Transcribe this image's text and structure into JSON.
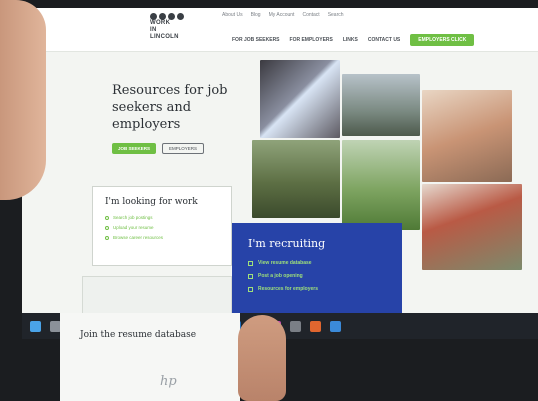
{
  "header": {
    "logo_text": [
      "WORK",
      "IN",
      "LINCOLN"
    ],
    "utility_links": [
      "About Us",
      "Blog",
      "My Account",
      "Contact",
      "Search"
    ],
    "nav_items": [
      "FOR JOB SEEKERS",
      "FOR EMPLOYERS",
      "LINKS",
      "CONTACT US"
    ],
    "cta_label": "EMPLOYERS CLICK"
  },
  "hero": {
    "title": "Resources for job seekers and employers",
    "primary_button": "JOB SEEKERS",
    "secondary_button": "EMPLOYERS"
  },
  "card_work": {
    "title": "I'm looking for work",
    "links": [
      "Search job postings",
      "Upload your resume",
      "Browse career resources"
    ]
  },
  "card_recruit": {
    "title": "I'm recruiting",
    "links": [
      "View resume database",
      "Post a job opening",
      "Resources for employers"
    ]
  },
  "resume_section": {
    "title": "Join the resume database"
  },
  "device": {
    "brand": "hp"
  },
  "colors": {
    "accent_green": "#6fbf44",
    "recruit_blue": "#2743a8",
    "text_dark": "#2b3035"
  },
  "taskbar_icons": [
    "start-icon",
    "search-icon",
    "taskview-icon",
    "edge-icon",
    "explorer-icon",
    "store-icon",
    "mail-icon",
    "chrome-icon",
    "word-icon",
    "excel-icon",
    "outlook-icon",
    "teams-icon",
    "photos-icon",
    "settings-icon",
    "media-icon",
    "calendar-icon"
  ]
}
